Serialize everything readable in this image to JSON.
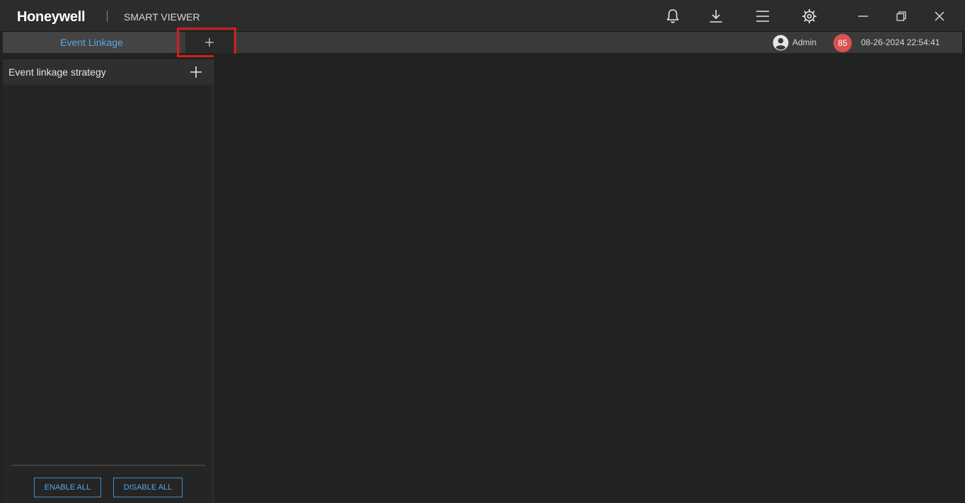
{
  "app": {
    "brand": "Honeywell",
    "title": "SMART VIEWER"
  },
  "toolbar": {
    "icons": [
      "bell-icon",
      "download-icon",
      "menu-icon",
      "gear-icon",
      "minimize-icon",
      "restore-icon",
      "close-icon"
    ]
  },
  "tabs": {
    "active_label": "Event Linkage",
    "add_label": "+"
  },
  "status": {
    "user": "Admin",
    "notification_count": "85",
    "datetime": "08-26-2024 22:54:41"
  },
  "panel": {
    "title": "Event linkage strategy",
    "enable_all_label": "ENABLE ALL",
    "disable_all_label": "DISABLE ALL"
  },
  "colors": {
    "accent": "#5aa6e0",
    "highlight": "#d01f1f",
    "badge": "#d9534f",
    "background": "#222222"
  }
}
